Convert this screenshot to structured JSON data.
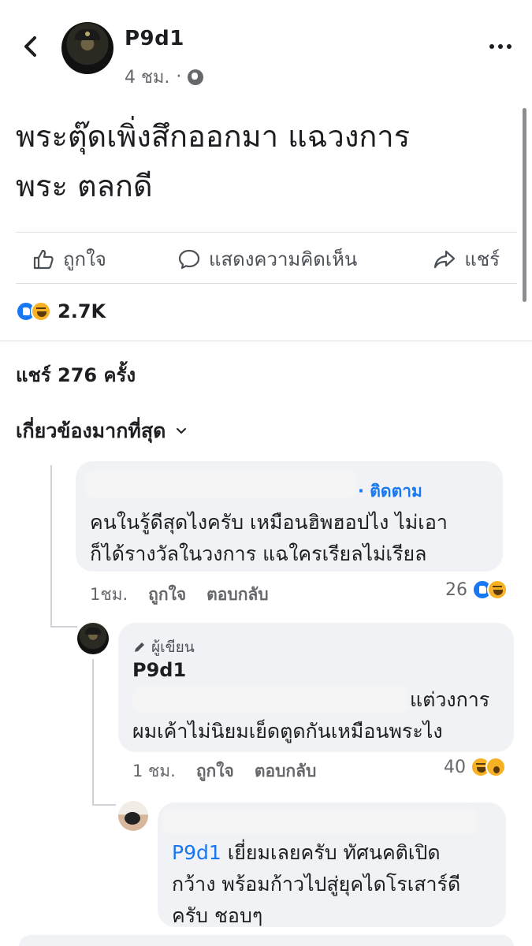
{
  "post": {
    "author": "P9d1",
    "time": "4 ชม.",
    "separator": "·",
    "text_line1": "พระตุ๊ดเพิ่งสึกออกมา แฉวงการ",
    "text_line2": "พระ ตลกดี",
    "privacy_icon": "globe-icon"
  },
  "actions": {
    "like": "ถูกใจ",
    "comment": "แสดงความคิดเห็น",
    "share": "แชร์"
  },
  "reactions": {
    "icons": [
      "like-icon",
      "haha-icon"
    ],
    "count": "2.7K"
  },
  "shares_text": "แชร์ 276 ครั้ง",
  "sort_label": "เกี่ยวข้องมากที่สุด",
  "comments": [
    {
      "follow_label": "· ติดตาม",
      "line1": "คนในรู้ดีสุดไงครับ เหมือนฮิพฮอปไง ไม่เอา",
      "line2": "ก็ได้รางวัลในวงการ แฉใครเรียลไม่เรียล",
      "time": "1ชม.",
      "like": "ถูกใจ",
      "reply": "ตอบกลับ",
      "count": "26",
      "reaction_icons": [
        "like-icon",
        "haha-icon"
      ]
    },
    {
      "badge": "ผู้เขียน",
      "author": "P9d1",
      "line1": "แต่วงการ",
      "line2": "ผมเค้าไม่นิยมเย็ดตูดกันเหมือนพระไง",
      "time": "1 ชม.",
      "like": "ถูกใจ",
      "reply": "ตอบกลับ",
      "count": "40",
      "reaction_icons": [
        "haha-icon",
        "wow-icon"
      ]
    },
    {
      "mention": "P9d1",
      "line1": " เยี่ยมเลยครับ ทัศนคติเปิด",
      "line2": "กว้าง พร้อมก้าวไปสู่ยุคไดโรเสาร์ดี",
      "line3": "ครับ ชอบๆ"
    }
  ],
  "colors": {
    "accent": "#1877f2",
    "bubble": "#f0f2f5",
    "secondary_text": "#65676b"
  }
}
